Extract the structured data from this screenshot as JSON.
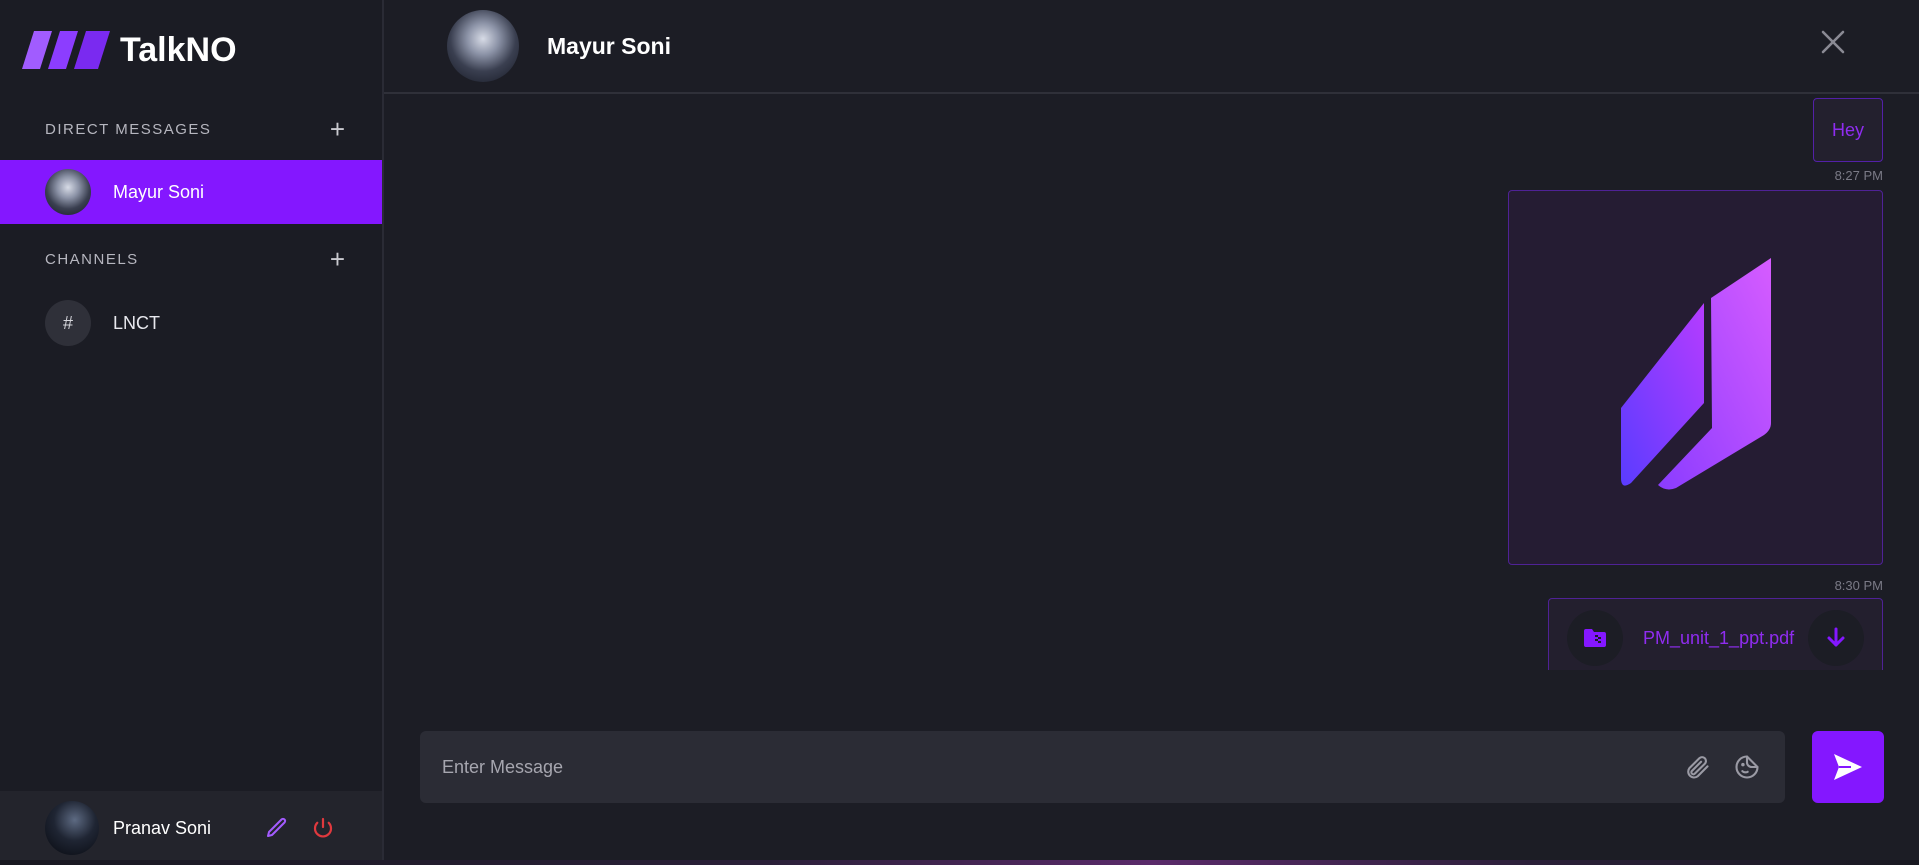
{
  "app": {
    "name": "TalkNO",
    "accent": "#8417ff",
    "danger": "#e0393e"
  },
  "sidebar": {
    "dm_section_label": "DIRECT MESSAGES",
    "channels_section_label": "CHANNELS",
    "direct_messages": [
      {
        "name": "Mayur Soni",
        "active": true
      }
    ],
    "channels": [
      {
        "symbol": "#",
        "name": "LNCT"
      }
    ],
    "profile": {
      "name": "Pranav Soni",
      "edit_icon": "pencil-icon",
      "logout_icon": "power-icon"
    }
  },
  "chat": {
    "contact_name": "Mayur Soni",
    "close_icon": "close-icon",
    "messages": [
      {
        "type": "text",
        "text": "Hey",
        "time": "8:27 PM"
      },
      {
        "type": "image",
        "icon": "talkno-logo",
        "time": "8:30 PM"
      },
      {
        "type": "file",
        "file_name": "PM_unit_1_ppt.pdf",
        "icon": "folder-zip-icon",
        "action_icon": "download-arrow-icon"
      }
    ]
  },
  "composer": {
    "placeholder": "Enter Message",
    "attach_icon": "paperclip-icon",
    "emoji_icon": "emoji-sticker-icon",
    "send_icon": "send-icon"
  }
}
